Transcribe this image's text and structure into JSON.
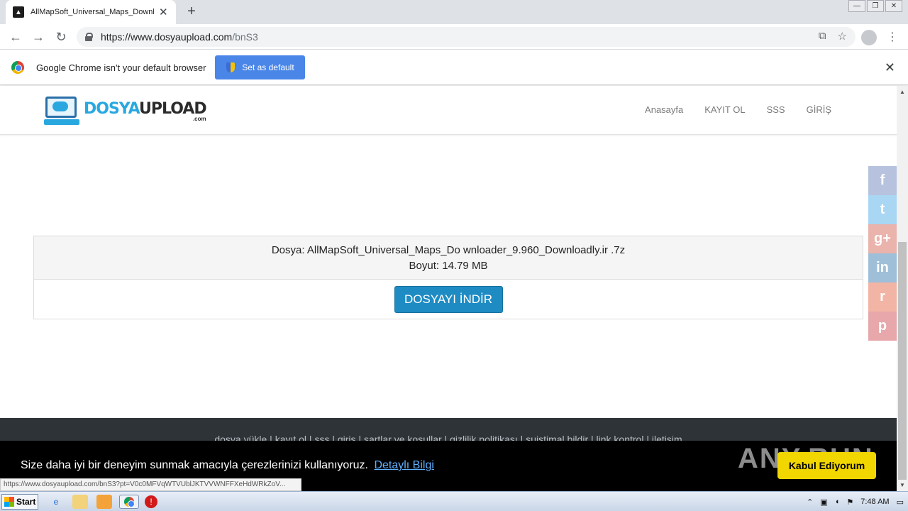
{
  "browser": {
    "tab_title": "AllMapSoft_Universal_Maps_Downlo",
    "tab_close": "✕",
    "new_tab": "+",
    "url_host": "https://www.dosyaupload.com",
    "url_path": "/bnS3",
    "back": "←",
    "forward": "→",
    "reload": "↻",
    "translate_icon": "⧉",
    "star_icon": "☆",
    "menu_icon": "⋮",
    "win_min": "—",
    "win_restore": "❐",
    "win_close": "✕"
  },
  "infobar": {
    "message": "Google Chrome isn't your default browser",
    "button": "Set as default",
    "close": "✕"
  },
  "site": {
    "logo_part1": "DOSYA",
    "logo_part2": "UPLOAD",
    "logo_sub": ".com",
    "nav": [
      "Anasayfa",
      "KAYIT OL",
      "SSS",
      "GİRİŞ"
    ]
  },
  "file": {
    "name_line": "Dosya: AllMapSoft_Universal_Maps_Do wnloader_9.960_Downloadly.ir .7z",
    "size_line": "Boyut: 14.79 MB",
    "download_button": "DOSYAYI İNDİR"
  },
  "social": [
    {
      "name": "facebook",
      "glyph": "f",
      "color": "#b7c3de"
    },
    {
      "name": "twitter",
      "glyph": "t",
      "color": "#a9d6f3"
    },
    {
      "name": "googleplus",
      "glyph": "g+",
      "color": "#eab3ac"
    },
    {
      "name": "linkedin",
      "glyph": "in",
      "color": "#9fbfd9"
    },
    {
      "name": "reddit",
      "glyph": "r",
      "color": "#f2b4a5"
    },
    {
      "name": "pinterest",
      "glyph": "p",
      "color": "#e7a7ab"
    }
  ],
  "footer": {
    "links": "dosya yükle  |  kayıt ol  |  sss  |  giriş  |  şartlar ve koşullar  |  gizlilik politikası  |  suistimal bildir  |  link kontrol  |  iletişim"
  },
  "cookie": {
    "text": "Size daha iyi bir deneyim sunmak amacıyla çerezlerinizi kullanıyoruz.",
    "more": "Detaylı Bilgi",
    "accept": "Kabul Ediyorum",
    "watermark": "ANY.RUN"
  },
  "status_url": "https://www.dosyaupload.com/bnS3?pt=V0c0MFVqWTVUblJKTVVWNFFXeHdWRkZoV...",
  "taskbar": {
    "start": "Start",
    "clock": "7:48 AM"
  }
}
